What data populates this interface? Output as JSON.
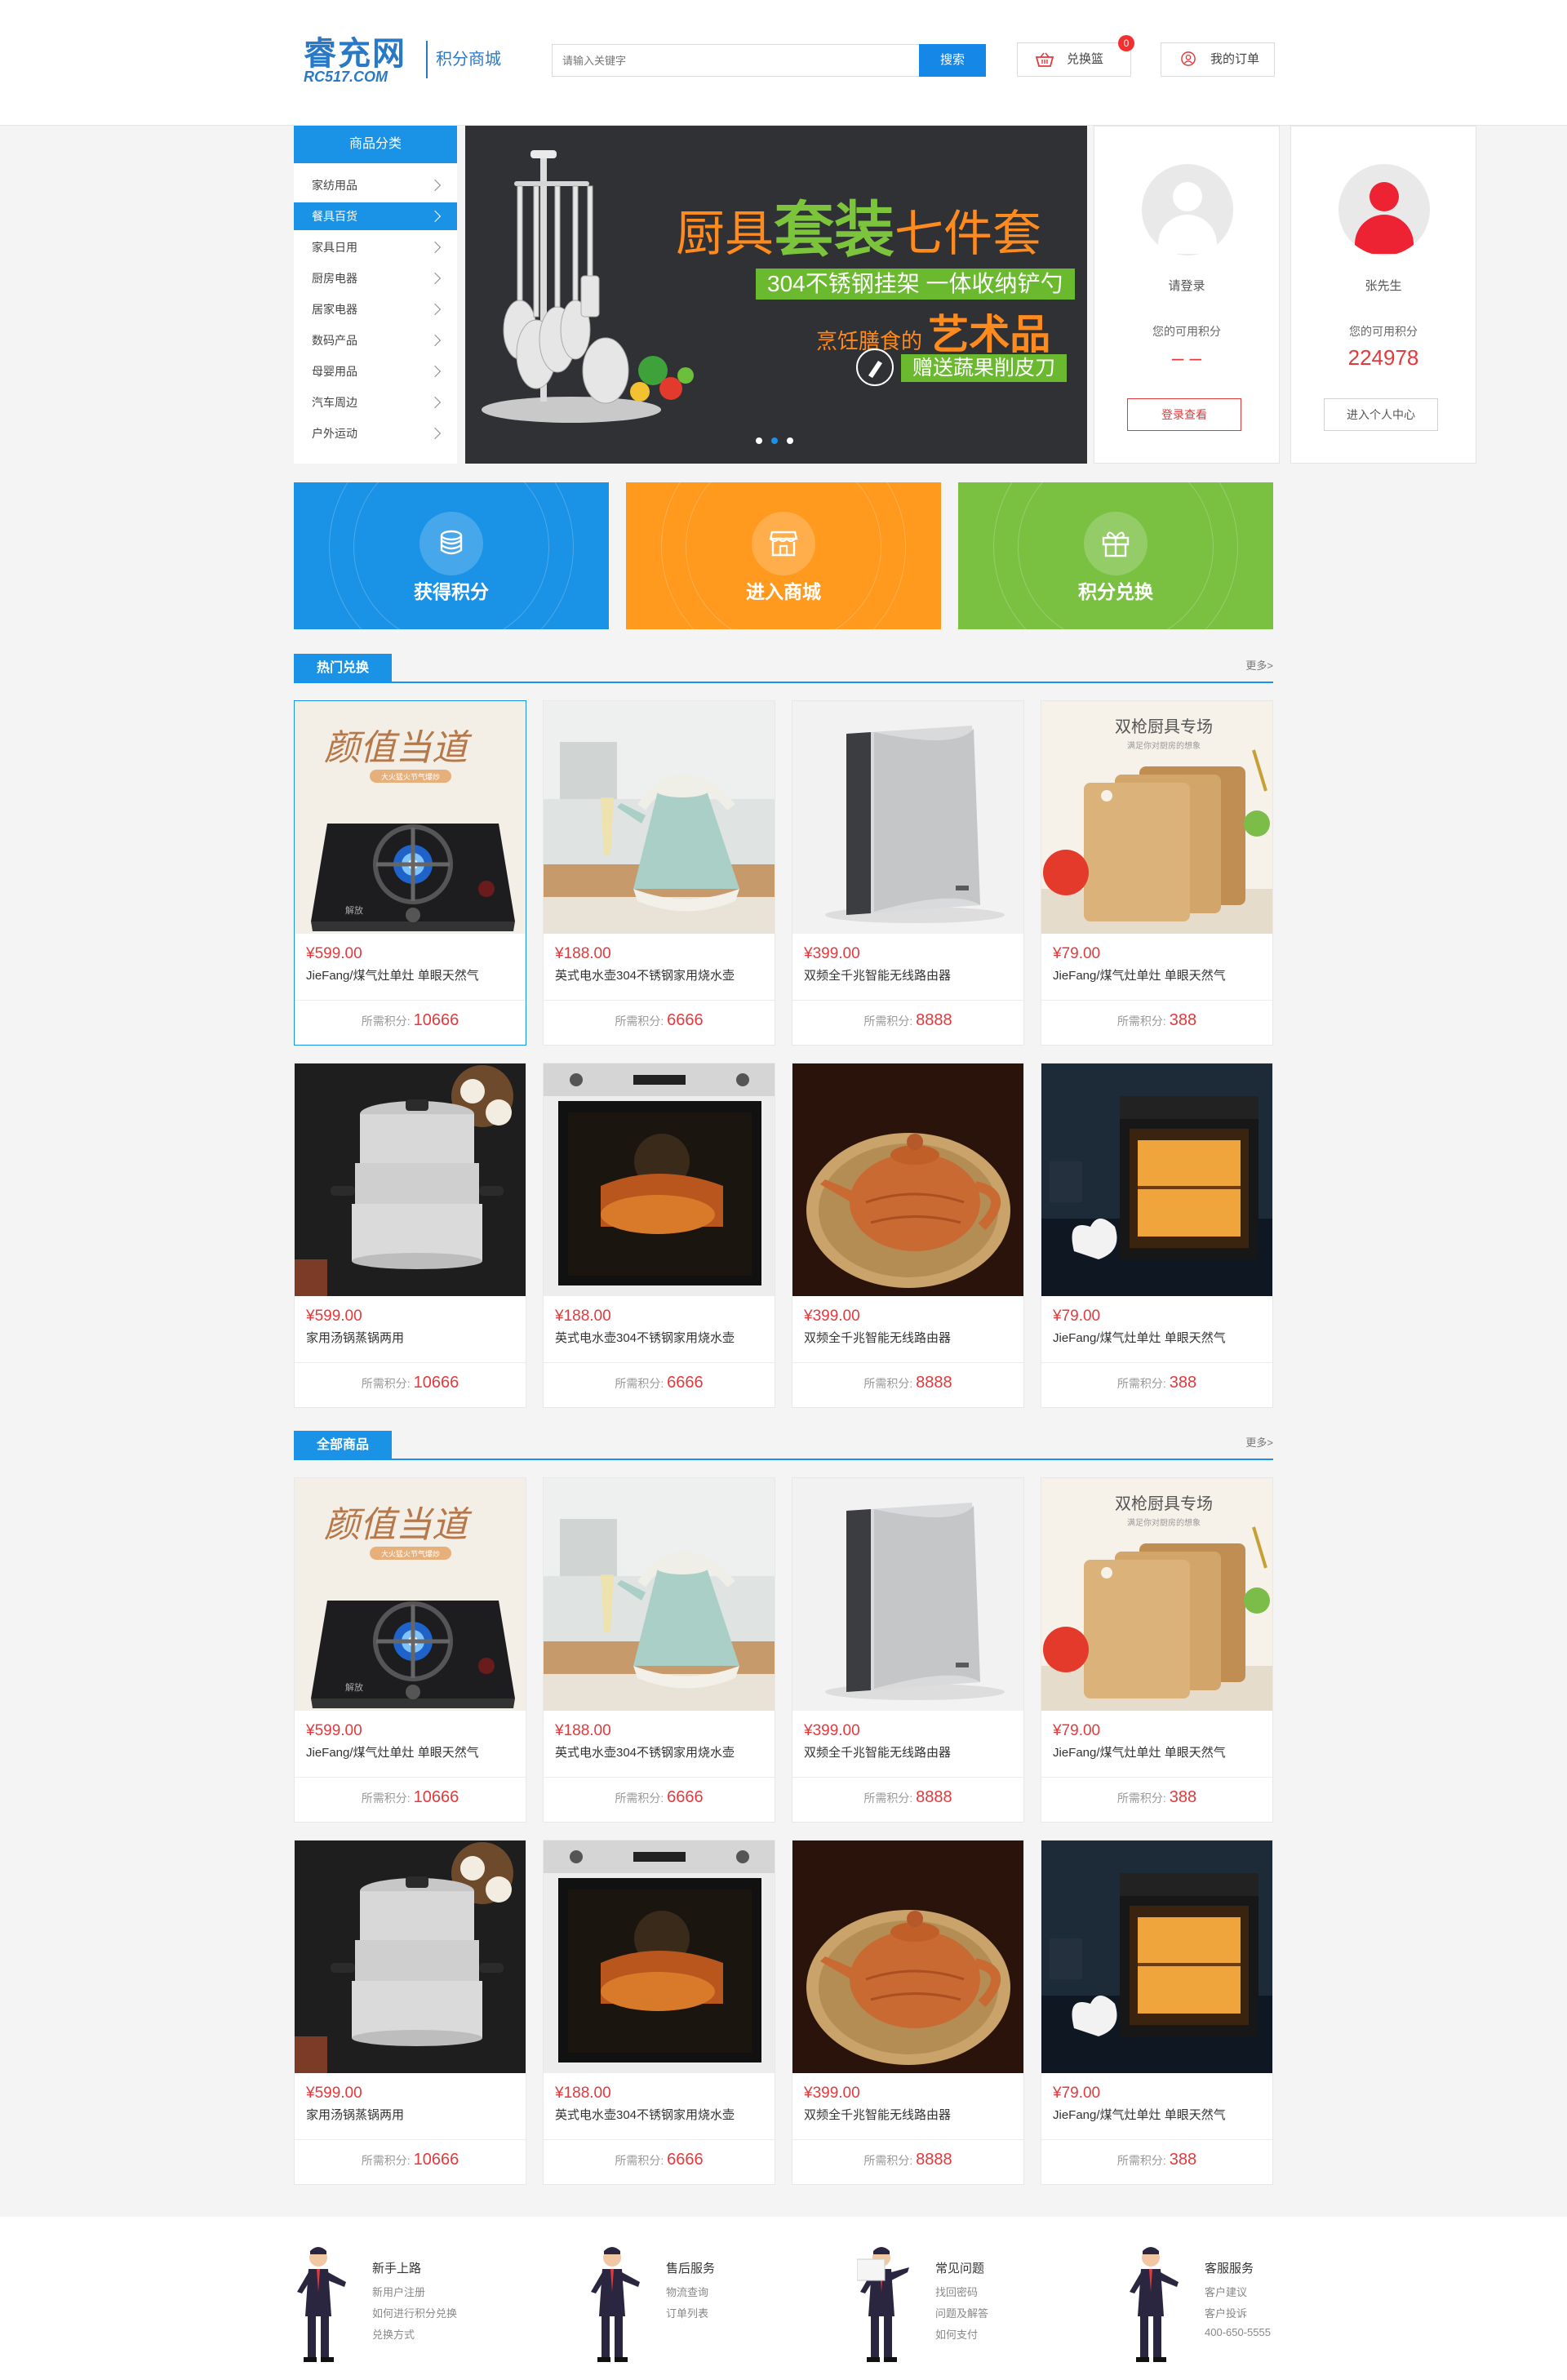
{
  "header": {
    "logo_main": "睿充网",
    "logo_sub": "RC517.COM",
    "logo_tag": "积分商城",
    "search_placeholder": "请输入关键字",
    "search_button": "搜索",
    "cart_label": "兑换篮",
    "cart_count": "0",
    "orders_label": "我的订单"
  },
  "categories": {
    "title": "商品分类",
    "items": [
      "家纺用品",
      "餐具百货",
      "家具日用",
      "厨房电器",
      "居家电器",
      "数码产品",
      "母婴用品",
      "汽车周边",
      "户外运动"
    ],
    "active_index": 1
  },
  "banner": {
    "line1_pre": "厨具",
    "line1_big": "套装",
    "line1_post": "七件套",
    "bar1": "304不锈钢挂架  一体收纳铲勺",
    "line3_pre": "烹饪膳食的",
    "line3_big": "艺术品",
    "bar2": "赠送蔬果削皮刀",
    "active_dot": 1
  },
  "guest_card": {
    "name": "请登录",
    "points_label": "您的可用积分",
    "points": "– –",
    "button": "登录查看"
  },
  "user_card": {
    "name": "张先生",
    "points_label": "您的可用积分",
    "points": "224978",
    "button": "进入个人中心"
  },
  "features": [
    {
      "label": "获得积分",
      "color": "#1a92e6",
      "icon": "coins-icon"
    },
    {
      "label": "进入商城",
      "color": "#ff9a1e",
      "icon": "store-icon"
    },
    {
      "label": "积分兑换",
      "color": "#7ac142",
      "icon": "gift-icon"
    }
  ],
  "sections": {
    "hot": {
      "title": "热门兑换",
      "more": "更多>"
    },
    "all": {
      "title": "全部商品",
      "more": "更多>"
    }
  },
  "points_label": "所需积分:",
  "products": [
    {
      "price": "¥599.00",
      "name": "JieFang/煤气灶单灶 单眼天然气",
      "points": "10666",
      "image": "gas-stove"
    },
    {
      "price": "¥188.00",
      "name": "英式电水壶304不锈钢家用烧水壶",
      "points": "6666",
      "image": "kettle"
    },
    {
      "price": "¥399.00",
      "name": "双频全千兆智能无线路由器",
      "points": "8888",
      "image": "router"
    },
    {
      "price": "¥79.00",
      "name": "JieFang/煤气灶单灶 单眼天然气",
      "points": "388",
      "image": "cutting-board"
    },
    {
      "price": "¥599.00",
      "name": "家用汤锅蒸锅两用",
      "points": "10666",
      "image": "steamer-pot"
    },
    {
      "price": "¥188.00",
      "name": "英式电水壶304不锈钢家用烧水壶",
      "points": "6666",
      "image": "oven"
    },
    {
      "price": "¥399.00",
      "name": "双频全千兆智能无线路由器",
      "points": "8888",
      "image": "teapot"
    },
    {
      "price": "¥79.00",
      "name": "JieFang/煤气灶单灶 单眼天然气",
      "points": "388",
      "image": "built-in-oven"
    }
  ],
  "product_image_text": {
    "stove_banner": "颜值当道",
    "stove_sub": "大火猛火节气爆炒",
    "stove_brand": "解放",
    "board_title": "双枪厨具专场",
    "board_sub": "满足你对厨房的想象"
  },
  "footer": [
    {
      "title": "新手上路",
      "links": [
        "新用户注册",
        "如何进行积分兑换",
        "兑换方式"
      ]
    },
    {
      "title": "售后服务",
      "links": [
        "物流查询",
        "订单列表"
      ]
    },
    {
      "title": "常见问题",
      "links": [
        "找回密码",
        "问题及解答",
        "如何支付"
      ]
    },
    {
      "title": "客服服务",
      "links": [
        "客户建议",
        "客户投诉",
        "400-650-5555"
      ]
    }
  ]
}
